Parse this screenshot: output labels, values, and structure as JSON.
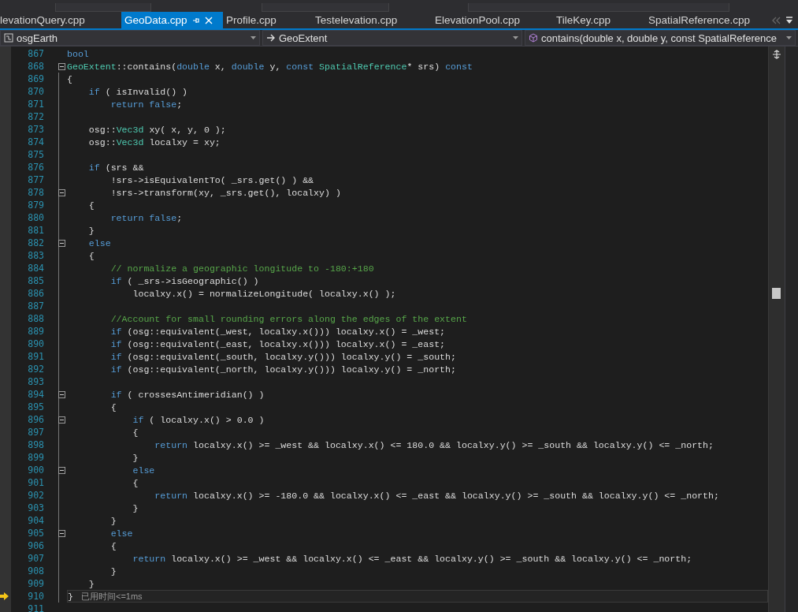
{
  "tabs": [
    {
      "label": "levationQuery.cpp",
      "selected": false
    },
    {
      "label": "GeoData.cpp",
      "selected": true
    },
    {
      "label": "Profile.cpp",
      "selected": false
    },
    {
      "label": "Testelevation.cpp",
      "selected": false
    },
    {
      "label": "ElevationPool.cpp",
      "selected": false
    },
    {
      "label": "TileKey.cpp",
      "selected": false
    },
    {
      "label": "SpatialReference.cpp",
      "selected": false
    }
  ],
  "navigation": [
    {
      "label": "osgEarth",
      "kind": "project"
    },
    {
      "label": "GeoExtent",
      "kind": "scope"
    },
    {
      "label": "contains(double x, double y, const SpatialReference",
      "kind": "member"
    }
  ],
  "lines": [
    {
      "number": "867",
      "fold": false,
      "current": false,
      "tokens": [
        {
          "t": "bool",
          "kind": "kw"
        }
      ]
    },
    {
      "number": "868",
      "fold": true,
      "current": false,
      "tokens": [
        {
          "t": "GeoExtent",
          "kind": "type"
        },
        {
          "t": "::contains(",
          "kind": "plain"
        },
        {
          "t": "double",
          "kind": "kw"
        },
        {
          "t": " x, ",
          "kind": "plain"
        },
        {
          "t": "double",
          "kind": "kw"
        },
        {
          "t": " y, ",
          "kind": "plain"
        },
        {
          "t": "const",
          "kind": "kw"
        },
        {
          "t": " SpatialReference",
          "kind": "type"
        },
        {
          "t": "* srs) ",
          "kind": "plain"
        },
        {
          "t": "const",
          "kind": "kw"
        }
      ]
    },
    {
      "number": "869",
      "fold": false,
      "current": false,
      "tokens": [
        {
          "t": "{",
          "kind": "plain"
        }
      ]
    },
    {
      "number": "870",
      "fold": false,
      "current": false,
      "tokens": [
        {
          "t": "    if",
          "kind": "kw"
        },
        {
          "t": " ( isInvalid() )",
          "kind": "plain"
        }
      ]
    },
    {
      "number": "871",
      "fold": false,
      "current": false,
      "tokens": [
        {
          "t": "        return false",
          "kind": "kw"
        },
        {
          "t": ";",
          "kind": "plain"
        }
      ]
    },
    {
      "number": "872",
      "fold": false,
      "current": false
    },
    {
      "number": "873",
      "fold": false,
      "current": false,
      "tokens": [
        {
          "t": "    osg::",
          "kind": "plain"
        },
        {
          "t": "Vec3d",
          "kind": "type"
        },
        {
          "t": " xy( x, y, 0 );",
          "kind": "plain"
        }
      ]
    },
    {
      "number": "874",
      "fold": false,
      "current": false,
      "tokens": [
        {
          "t": "    osg::",
          "kind": "plain"
        },
        {
          "t": "Vec3d",
          "kind": "type"
        },
        {
          "t": " localxy = xy;",
          "kind": "plain"
        }
      ]
    },
    {
      "number": "875",
      "fold": false,
      "current": false
    },
    {
      "number": "876",
      "fold": false,
      "current": false,
      "tokens": [
        {
          "t": "    if",
          "kind": "kw"
        },
        {
          "t": " (srs &&",
          "kind": "plain"
        }
      ]
    },
    {
      "number": "877",
      "fold": false,
      "current": false,
      "tokens": [
        {
          "t": "        !srs->isEquivalentTo( _srs.get() ) &&",
          "kind": "plain"
        }
      ]
    },
    {
      "number": "878",
      "fold": true,
      "current": false,
      "tokens": [
        {
          "t": "        !srs->transform(xy, _srs.get(), localxy) )",
          "kind": "plain"
        }
      ]
    },
    {
      "number": "879",
      "fold": false,
      "current": false,
      "tokens": [
        {
          "t": "    {",
          "kind": "plain"
        }
      ]
    },
    {
      "number": "880",
      "fold": false,
      "current": false,
      "tokens": [
        {
          "t": "        return false",
          "kind": "kw"
        },
        {
          "t": ";",
          "kind": "plain"
        }
      ]
    },
    {
      "number": "881",
      "fold": false,
      "current": false,
      "tokens": [
        {
          "t": "    }",
          "kind": "plain"
        }
      ]
    },
    {
      "number": "882",
      "fold": true,
      "current": false,
      "tokens": [
        {
          "t": "    else",
          "kind": "kw"
        }
      ]
    },
    {
      "number": "883",
      "fold": false,
      "current": false,
      "tokens": [
        {
          "t": "    {",
          "kind": "plain"
        }
      ]
    },
    {
      "number": "884",
      "fold": false,
      "current": false,
      "tokens": [
        {
          "t": "        // normalize a geographic longitude to -180:+180",
          "kind": "comment"
        }
      ]
    },
    {
      "number": "885",
      "fold": false,
      "current": false,
      "tokens": [
        {
          "t": "        if",
          "kind": "kw"
        },
        {
          "t": " ( _srs->isGeographic() )",
          "kind": "plain"
        }
      ]
    },
    {
      "number": "886",
      "fold": false,
      "current": false,
      "tokens": [
        {
          "t": "            localxy.x() = normalizeLongitude( localxy.x() );",
          "kind": "plain"
        }
      ]
    },
    {
      "number": "887",
      "fold": false,
      "current": false
    },
    {
      "number": "888",
      "fold": false,
      "current": false,
      "tokens": [
        {
          "t": "        //Account for small rounding errors along the edges of the extent",
          "kind": "comment"
        }
      ]
    },
    {
      "number": "889",
      "fold": false,
      "current": false,
      "tokens": [
        {
          "t": "        if",
          "kind": "kw"
        },
        {
          "t": " (osg::equivalent(_west, localxy.x())) localxy.x() = _west;",
          "kind": "plain"
        }
      ]
    },
    {
      "number": "890",
      "fold": false,
      "current": false,
      "tokens": [
        {
          "t": "        if",
          "kind": "kw"
        },
        {
          "t": " (osg::equivalent(_east, localxy.x())) localxy.x() = _east;",
          "kind": "plain"
        }
      ]
    },
    {
      "number": "891",
      "fold": false,
      "current": false,
      "tokens": [
        {
          "t": "        if",
          "kind": "kw"
        },
        {
          "t": " (osg::equivalent(_south, localxy.y())) localxy.y() = _south;",
          "kind": "plain"
        }
      ]
    },
    {
      "number": "892",
      "fold": false,
      "current": false,
      "tokens": [
        {
          "t": "        if",
          "kind": "kw"
        },
        {
          "t": " (osg::equivalent(_north, localxy.y())) localxy.y() = _north;",
          "kind": "plain"
        }
      ]
    },
    {
      "number": "893",
      "fold": false,
      "current": false
    },
    {
      "number": "894",
      "fold": true,
      "current": false,
      "tokens": [
        {
          "t": "        if",
          "kind": "kw"
        },
        {
          "t": " ( crossesAntimeridian() )",
          "kind": "plain"
        }
      ]
    },
    {
      "number": "895",
      "fold": false,
      "current": false,
      "tokens": [
        {
          "t": "        {",
          "kind": "plain"
        }
      ]
    },
    {
      "number": "896",
      "fold": true,
      "current": false,
      "tokens": [
        {
          "t": "            if",
          "kind": "kw"
        },
        {
          "t": " ( localxy.x() > 0.0 )",
          "kind": "plain"
        }
      ]
    },
    {
      "number": "897",
      "fold": false,
      "current": false,
      "tokens": [
        {
          "t": "            {",
          "kind": "plain"
        }
      ]
    },
    {
      "number": "898",
      "fold": false,
      "current": false,
      "tokens": [
        {
          "t": "                return",
          "kind": "kw"
        },
        {
          "t": " localxy.x() >= _west && localxy.x() <= 180.0 && localxy.y() >= _south && localxy.y() <= _north;",
          "kind": "plain"
        }
      ]
    },
    {
      "number": "899",
      "fold": false,
      "current": false,
      "tokens": [
        {
          "t": "            }",
          "kind": "plain"
        }
      ]
    },
    {
      "number": "900",
      "fold": true,
      "current": false,
      "tokens": [
        {
          "t": "            else",
          "kind": "kw"
        }
      ]
    },
    {
      "number": "901",
      "fold": false,
      "current": false,
      "tokens": [
        {
          "t": "            {",
          "kind": "plain"
        }
      ]
    },
    {
      "number": "902",
      "fold": false,
      "current": false,
      "tokens": [
        {
          "t": "                return",
          "kind": "kw"
        },
        {
          "t": " localxy.x() >= -180.0 && localxy.x() <= _east && localxy.y() >= _south && localxy.y() <= _north;",
          "kind": "plain"
        }
      ]
    },
    {
      "number": "903",
      "fold": false,
      "current": false,
      "tokens": [
        {
          "t": "            }",
          "kind": "plain"
        }
      ]
    },
    {
      "number": "904",
      "fold": false,
      "current": false,
      "tokens": [
        {
          "t": "        }",
          "kind": "plain"
        }
      ]
    },
    {
      "number": "905",
      "fold": true,
      "current": false,
      "tokens": [
        {
          "t": "        else",
          "kind": "kw"
        }
      ]
    },
    {
      "number": "906",
      "fold": false,
      "current": false,
      "tokens": [
        {
          "t": "        {",
          "kind": "plain"
        }
      ]
    },
    {
      "number": "907",
      "fold": false,
      "current": false,
      "tokens": [
        {
          "t": "            return",
          "kind": "kw"
        },
        {
          "t": " localxy.x() >= _west && localxy.x() <= _east && localxy.y() >= _south && localxy.y() <= _north;",
          "kind": "plain"
        }
      ]
    },
    {
      "number": "908",
      "fold": false,
      "current": false,
      "tokens": [
        {
          "t": "        }",
          "kind": "plain"
        }
      ]
    },
    {
      "number": "909",
      "fold": false,
      "current": false,
      "tokens": [
        {
          "t": "    }",
          "kind": "plain"
        }
      ]
    },
    {
      "number": "910",
      "fold": false,
      "current": true,
      "tokens": [
        {
          "t": "}",
          "kind": "plain"
        }
      ],
      "perf_tip": "已用时间<=1ms"
    },
    {
      "number": "911",
      "fold": false,
      "current": false
    }
  ]
}
